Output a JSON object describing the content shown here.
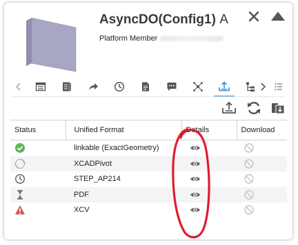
{
  "header": {
    "title": "AsyncDO(Config1)",
    "revision": "A",
    "member_label": "Platform Member"
  },
  "tabs": [
    {
      "icon": "summary-icon"
    },
    {
      "icon": "properties-icon"
    },
    {
      "icon": "share-icon"
    },
    {
      "icon": "history-icon"
    },
    {
      "icon": "document-icon"
    },
    {
      "icon": "comments-icon"
    },
    {
      "icon": "relations-icon"
    },
    {
      "icon": "export-icon",
      "active": true
    },
    {
      "icon": "structure-icon"
    }
  ],
  "table": {
    "columns": {
      "status": "Status",
      "format": "Unified Format",
      "details": "Details",
      "download": "Download"
    },
    "rows": [
      {
        "status": "success-icon",
        "format": "linkable (ExactGeometry)"
      },
      {
        "status": "in-progress-icon",
        "format": "XCADPivot"
      },
      {
        "status": "waiting-icon",
        "format": "STEP_AP214"
      },
      {
        "status": "queued-icon",
        "format": "PDF"
      },
      {
        "status": "error-icon",
        "format": "XCV"
      }
    ]
  },
  "colors": {
    "accent": "#3b8fd1",
    "success": "#5cb85c",
    "error": "#d9534f",
    "annotation": "#e01b2f"
  }
}
